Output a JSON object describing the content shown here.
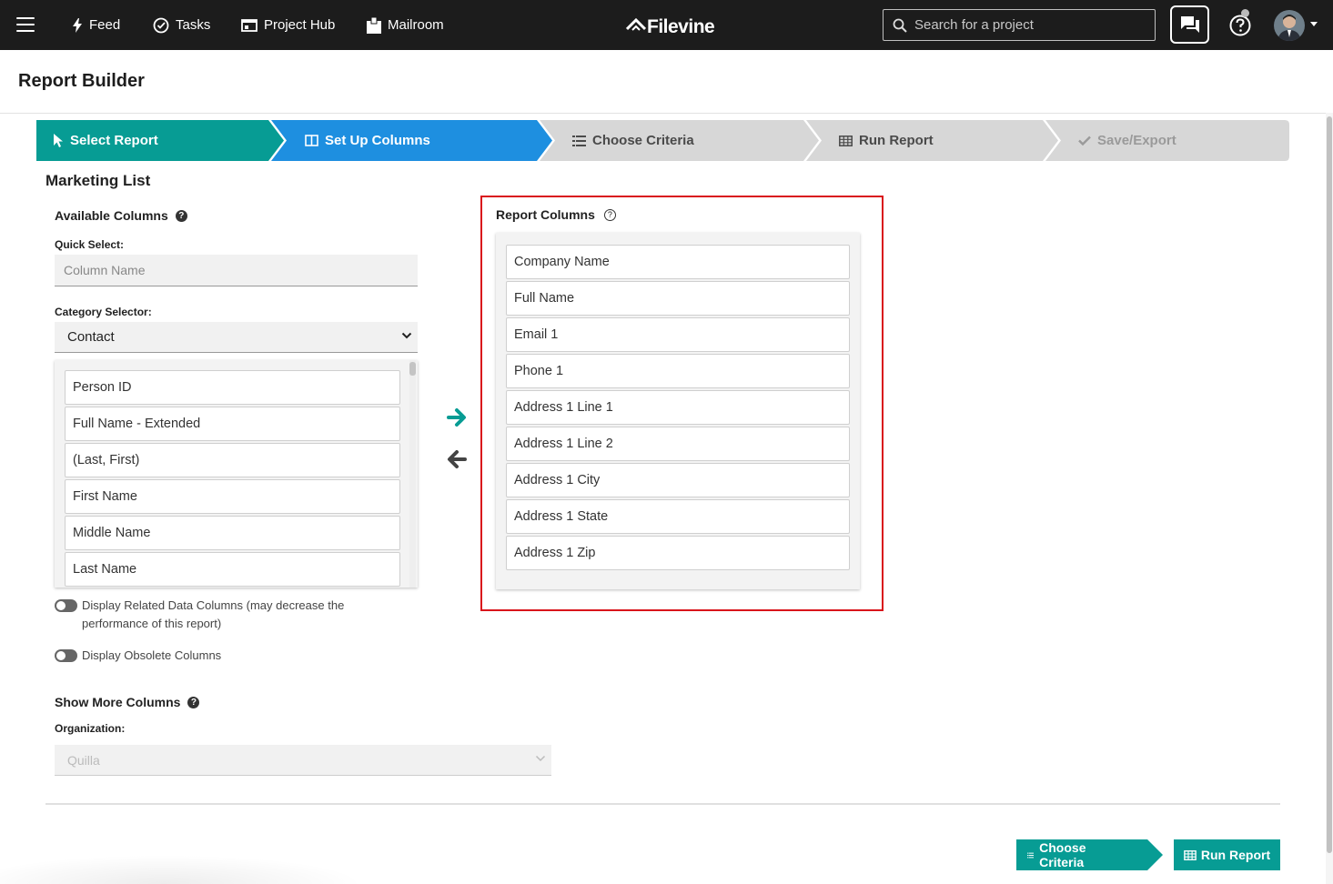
{
  "topnav": {
    "items": [
      {
        "label": "Feed",
        "icon": "bolt-icon"
      },
      {
        "label": "Tasks",
        "icon": "check-circle-icon"
      },
      {
        "label": "Project Hub",
        "icon": "hub-icon"
      },
      {
        "label": "Mailroom",
        "icon": "mailroom-icon"
      }
    ],
    "logo": "Filevine",
    "search_placeholder": "Search for a project"
  },
  "page_title": "Report Builder",
  "steps": [
    {
      "label": "Select Report",
      "state": "done",
      "color": "#079c94"
    },
    {
      "label": "Set Up Columns",
      "state": "active",
      "color": "#1e8fe0"
    },
    {
      "label": "Choose Criteria",
      "state": "pending",
      "color": "#d7d7d7"
    },
    {
      "label": "Run Report",
      "state": "pending",
      "color": "#d7d7d7"
    },
    {
      "label": "Save/Export",
      "state": "disabled",
      "color": "#d7d7d7"
    }
  ],
  "report_name": "Marketing List",
  "available": {
    "label": "Available Columns",
    "quick_select_label": "Quick Select:",
    "quick_select_placeholder": "Column Name",
    "category_label": "Category Selector:",
    "category_value": "Contact",
    "items": [
      "Person ID",
      "Full Name - Extended",
      "(Last, First)",
      "First Name",
      "Middle Name",
      "Last Name"
    ]
  },
  "toggles": {
    "related_line1": "Display Related Data Columns (may decrease the",
    "related_line2": "performance of this report)",
    "obsolete": "Display Obsolete Columns"
  },
  "more": {
    "label": "Show More Columns",
    "org_label": "Organization:",
    "org_value": "Quilla"
  },
  "report_columns": {
    "label": "Report Columns",
    "items": [
      "Company Name",
      "Full Name",
      "Email 1",
      "Phone 1",
      "Address 1 Line 1",
      "Address 1 Line 2",
      "Address 1 City",
      "Address 1 State",
      "Address 1 Zip"
    ]
  },
  "footer": {
    "choose_criteria": "Choose Criteria",
    "run_report": "Run Report"
  },
  "colors": {
    "teal": "#079c94",
    "blue": "#1e8fe0",
    "highlight_border": "#d9141b"
  }
}
